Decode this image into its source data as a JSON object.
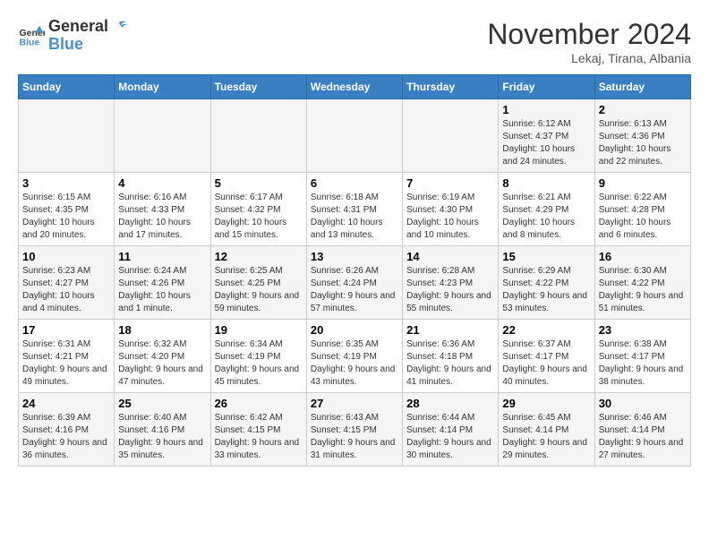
{
  "header": {
    "logo_general": "General",
    "logo_blue": "Blue",
    "month_title": "November 2024",
    "location": "Lekaj, Tirana, Albania"
  },
  "weekdays": [
    "Sunday",
    "Monday",
    "Tuesday",
    "Wednesday",
    "Thursday",
    "Friday",
    "Saturday"
  ],
  "weeks": [
    [
      {
        "day": "",
        "info": ""
      },
      {
        "day": "",
        "info": ""
      },
      {
        "day": "",
        "info": ""
      },
      {
        "day": "",
        "info": ""
      },
      {
        "day": "",
        "info": ""
      },
      {
        "day": "1",
        "info": "Sunrise: 6:12 AM\nSunset: 4:37 PM\nDaylight: 10 hours and 24 minutes."
      },
      {
        "day": "2",
        "info": "Sunrise: 6:13 AM\nSunset: 4:36 PM\nDaylight: 10 hours and 22 minutes."
      }
    ],
    [
      {
        "day": "3",
        "info": "Sunrise: 6:15 AM\nSunset: 4:35 PM\nDaylight: 10 hours and 20 minutes."
      },
      {
        "day": "4",
        "info": "Sunrise: 6:16 AM\nSunset: 4:33 PM\nDaylight: 10 hours and 17 minutes."
      },
      {
        "day": "5",
        "info": "Sunrise: 6:17 AM\nSunset: 4:32 PM\nDaylight: 10 hours and 15 minutes."
      },
      {
        "day": "6",
        "info": "Sunrise: 6:18 AM\nSunset: 4:31 PM\nDaylight: 10 hours and 13 minutes."
      },
      {
        "day": "7",
        "info": "Sunrise: 6:19 AM\nSunset: 4:30 PM\nDaylight: 10 hours and 10 minutes."
      },
      {
        "day": "8",
        "info": "Sunrise: 6:21 AM\nSunset: 4:29 PM\nDaylight: 10 hours and 8 minutes."
      },
      {
        "day": "9",
        "info": "Sunrise: 6:22 AM\nSunset: 4:28 PM\nDaylight: 10 hours and 6 minutes."
      }
    ],
    [
      {
        "day": "10",
        "info": "Sunrise: 6:23 AM\nSunset: 4:27 PM\nDaylight: 10 hours and 4 minutes."
      },
      {
        "day": "11",
        "info": "Sunrise: 6:24 AM\nSunset: 4:26 PM\nDaylight: 10 hours and 1 minute."
      },
      {
        "day": "12",
        "info": "Sunrise: 6:25 AM\nSunset: 4:25 PM\nDaylight: 9 hours and 59 minutes."
      },
      {
        "day": "13",
        "info": "Sunrise: 6:26 AM\nSunset: 4:24 PM\nDaylight: 9 hours and 57 minutes."
      },
      {
        "day": "14",
        "info": "Sunrise: 6:28 AM\nSunset: 4:23 PM\nDaylight: 9 hours and 55 minutes."
      },
      {
        "day": "15",
        "info": "Sunrise: 6:29 AM\nSunset: 4:22 PM\nDaylight: 9 hours and 53 minutes."
      },
      {
        "day": "16",
        "info": "Sunrise: 6:30 AM\nSunset: 4:22 PM\nDaylight: 9 hours and 51 minutes."
      }
    ],
    [
      {
        "day": "17",
        "info": "Sunrise: 6:31 AM\nSunset: 4:21 PM\nDaylight: 9 hours and 49 minutes."
      },
      {
        "day": "18",
        "info": "Sunrise: 6:32 AM\nSunset: 4:20 PM\nDaylight: 9 hours and 47 minutes."
      },
      {
        "day": "19",
        "info": "Sunrise: 6:34 AM\nSunset: 4:19 PM\nDaylight: 9 hours and 45 minutes."
      },
      {
        "day": "20",
        "info": "Sunrise: 6:35 AM\nSunset: 4:19 PM\nDaylight: 9 hours and 43 minutes."
      },
      {
        "day": "21",
        "info": "Sunrise: 6:36 AM\nSunset: 4:18 PM\nDaylight: 9 hours and 41 minutes."
      },
      {
        "day": "22",
        "info": "Sunrise: 6:37 AM\nSunset: 4:17 PM\nDaylight: 9 hours and 40 minutes."
      },
      {
        "day": "23",
        "info": "Sunrise: 6:38 AM\nSunset: 4:17 PM\nDaylight: 9 hours and 38 minutes."
      }
    ],
    [
      {
        "day": "24",
        "info": "Sunrise: 6:39 AM\nSunset: 4:16 PM\nDaylight: 9 hours and 36 minutes."
      },
      {
        "day": "25",
        "info": "Sunrise: 6:40 AM\nSunset: 4:16 PM\nDaylight: 9 hours and 35 minutes."
      },
      {
        "day": "26",
        "info": "Sunrise: 6:42 AM\nSunset: 4:15 PM\nDaylight: 9 hours and 33 minutes."
      },
      {
        "day": "27",
        "info": "Sunrise: 6:43 AM\nSunset: 4:15 PM\nDaylight: 9 hours and 31 minutes."
      },
      {
        "day": "28",
        "info": "Sunrise: 6:44 AM\nSunset: 4:14 PM\nDaylight: 9 hours and 30 minutes."
      },
      {
        "day": "29",
        "info": "Sunrise: 6:45 AM\nSunset: 4:14 PM\nDaylight: 9 hours and 29 minutes."
      },
      {
        "day": "30",
        "info": "Sunrise: 6:46 AM\nSunset: 4:14 PM\nDaylight: 9 hours and 27 minutes."
      }
    ]
  ]
}
